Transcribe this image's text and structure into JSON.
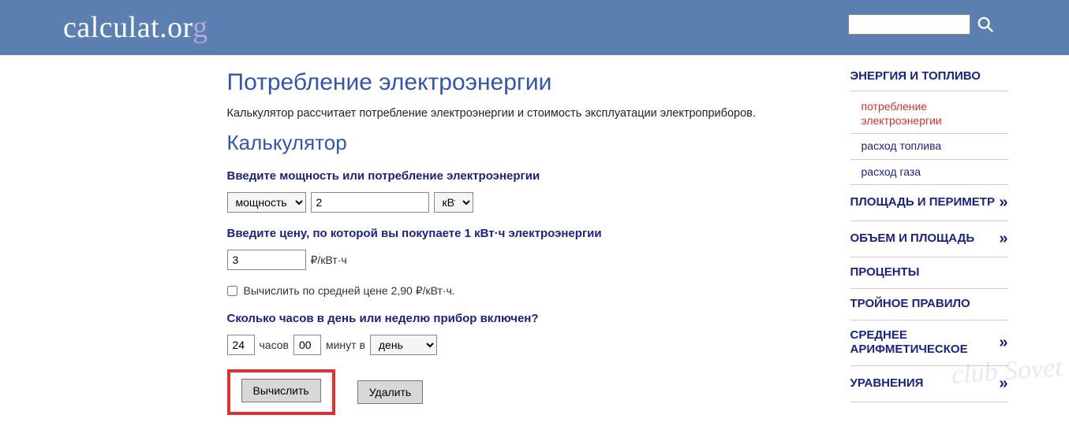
{
  "logo": {
    "text_a": "calculat",
    "dot": ".",
    "org_o": "o",
    "org_r": "r",
    "org_g": "g"
  },
  "search": {
    "value": ""
  },
  "main": {
    "title": "Потребление электроэнергии",
    "description": "Калькулятор рассчитает потребление электроэнергии и стоимость эксплуатации электроприборов.",
    "subtitle": "Калькулятор",
    "field1": {
      "label": "Введите мощность или потребление электроэнергии",
      "type_value": "мощность",
      "power_value": "2",
      "unit_value": "кВт"
    },
    "field2": {
      "label": "Введите цену, по которой вы покупаете 1 кВт·ч электроэнергии",
      "price_value": "3",
      "price_unit": "₽/кВт·ч",
      "avg_label": "Вычислить по средней цене 2,90 ₽/кВт·ч."
    },
    "field3": {
      "label": "Сколько часов в день или неделю прибор включен?",
      "hours_value": "24",
      "hours_label": "часов",
      "minutes_value": "00",
      "minutes_label": "минут в",
      "period_value": "день"
    },
    "buttons": {
      "calc": "Вычислить",
      "delete": "Удалить"
    }
  },
  "sidebar": {
    "group1_title": "ЭНЕРГИЯ И ТОПЛИВО",
    "group1_items": [
      {
        "label": "потребление электроэнергии",
        "active": true
      },
      {
        "label": "расход топлива"
      },
      {
        "label": "расход газа"
      }
    ],
    "headings": [
      {
        "label": "ПЛОЩАДЬ И ПЕРИМЕТР"
      },
      {
        "label": "ОБЪЕМ И ПЛОЩАДЬ"
      },
      {
        "label": "ПРОЦЕНТЫ"
      },
      {
        "label": "ТРОЙНОЕ ПРАВИЛО"
      },
      {
        "label": "СРЕДНЕЕ АРИФМЕТИЧЕСКОЕ"
      },
      {
        "label": "УРАВНЕНИЯ"
      }
    ]
  },
  "watermark": "club Sovet"
}
